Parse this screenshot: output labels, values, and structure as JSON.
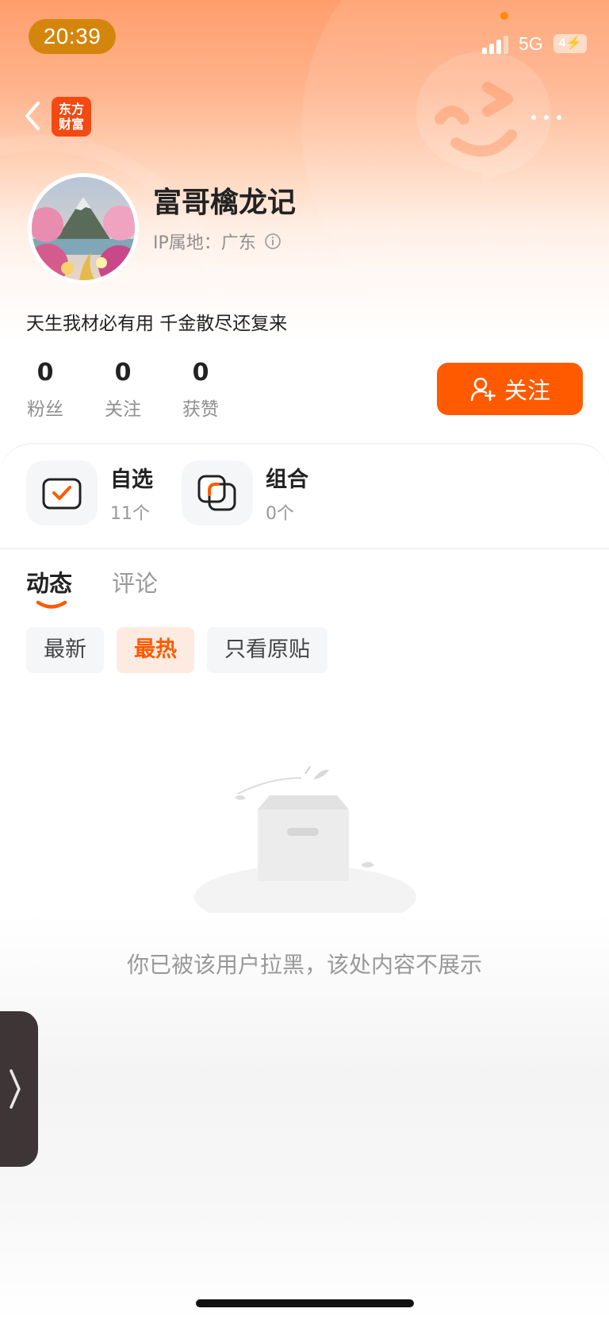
{
  "status_bar": {
    "time": "20:39",
    "network": "5G",
    "battery": "4"
  },
  "nav": {
    "app_logo_text": "东方财富"
  },
  "profile": {
    "username": "富哥檎龙记",
    "ip_location": "IP属地：广东",
    "bio": "天生我材必有用 千金散尽还复来",
    "stats": [
      {
        "value": "0",
        "label": "粉丝"
      },
      {
        "value": "0",
        "label": "关注"
      },
      {
        "value": "0",
        "label": "获赞"
      }
    ],
    "follow_label": "关注"
  },
  "shortcuts": [
    {
      "title": "自选",
      "sub": "11个"
    },
    {
      "title": "组合",
      "sub": "0个"
    }
  ],
  "tabs": [
    {
      "label": "动态",
      "active": true
    },
    {
      "label": "评论",
      "active": false
    }
  ],
  "filters": [
    {
      "label": "最新",
      "active": false
    },
    {
      "label": "最热",
      "active": true
    },
    {
      "label": "只看原贴",
      "active": false
    }
  ],
  "empty_state": {
    "message": "你已被该用户拉黑，该处内容不展示"
  },
  "colors": {
    "accent": "#ff5a00",
    "time_pill": "#d4860c",
    "logo": "#f24a12"
  }
}
